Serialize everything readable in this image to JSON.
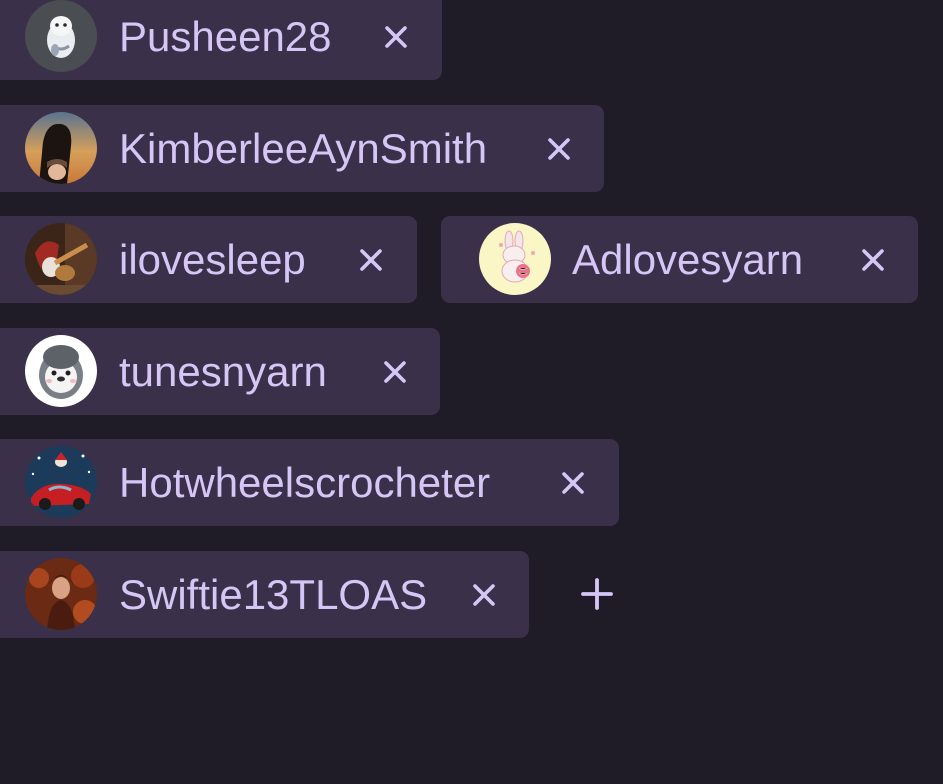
{
  "accent_color": "#d5c6f5",
  "chip_color": "#3a3049",
  "background_color": "#1f1b27",
  "users": [
    {
      "name": "Pusheen28",
      "avatar": "cat-plush-avatar",
      "remove_icon": "close-icon"
    },
    {
      "name": "KimberleeAynSmith",
      "avatar": "horse-sunset-avatar",
      "remove_icon": "close-icon"
    },
    {
      "name": "ilovesleep",
      "avatar": "santa-guitar-avatar",
      "remove_icon": "close-icon"
    },
    {
      "name": "Adlovesyarn",
      "avatar": "bunny-yarn-avatar",
      "remove_icon": "close-icon"
    },
    {
      "name": "tunesnyarn",
      "avatar": "penguin-avatar",
      "remove_icon": "close-icon"
    },
    {
      "name": "Hotwheelscrocheter",
      "avatar": "red-car-santa-avatar",
      "remove_icon": "close-icon"
    },
    {
      "name": "Swiftie13TLOAS",
      "avatar": "autumn-portrait-avatar",
      "remove_icon": "close-icon"
    }
  ],
  "add_icon": "plus-icon"
}
